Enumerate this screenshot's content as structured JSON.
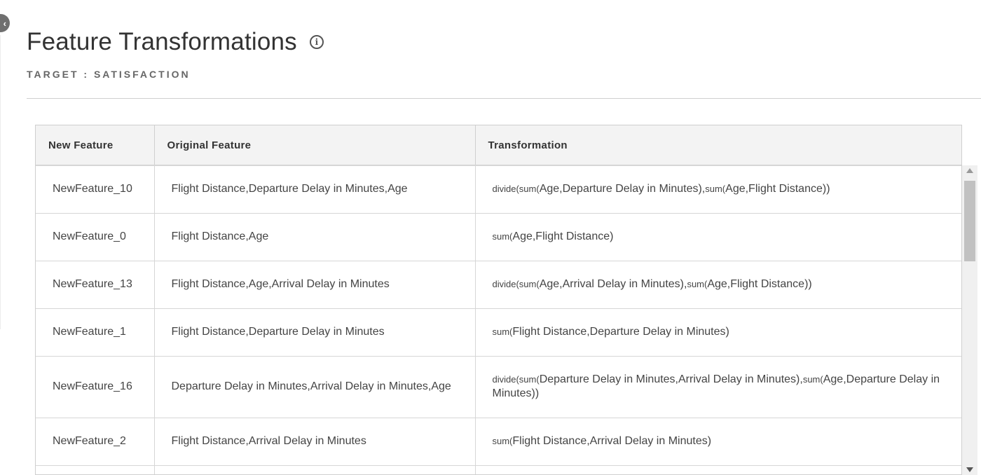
{
  "page": {
    "title": "Feature Transformations",
    "target_label": "TARGET : SATISFACTION"
  },
  "table": {
    "columns": [
      "New Feature",
      "Original Feature",
      "Transformation"
    ],
    "rows": [
      {
        "new_feature": "NewFeature_10",
        "original": "Flight Distance,Departure Delay in Minutes,Age",
        "transform": [
          {
            "t": "divide(",
            "fn": true
          },
          {
            "t": "sum(",
            "fn": true
          },
          {
            "t": "Age,Departure Delay in Minutes),",
            "fn": false
          },
          {
            "t": "sum(",
            "fn": true
          },
          {
            "t": "Age,Flight Distance))",
            "fn": false
          }
        ]
      },
      {
        "new_feature": "NewFeature_0",
        "original": "Flight Distance,Age",
        "transform": [
          {
            "t": "sum(",
            "fn": true
          },
          {
            "t": "Age,Flight Distance)",
            "fn": false
          }
        ]
      },
      {
        "new_feature": "NewFeature_13",
        "original": "Flight Distance,Age,Arrival Delay in Minutes",
        "transform": [
          {
            "t": "divide(",
            "fn": true
          },
          {
            "t": "sum(",
            "fn": true
          },
          {
            "t": "Age,Arrival Delay in Minutes),",
            "fn": false
          },
          {
            "t": "sum(",
            "fn": true
          },
          {
            "t": "Age,Flight Distance))",
            "fn": false
          }
        ]
      },
      {
        "new_feature": "NewFeature_1",
        "original": "Flight Distance,Departure Delay in Minutes",
        "transform": [
          {
            "t": "sum(",
            "fn": true
          },
          {
            "t": "Flight Distance,Departure Delay in Minutes)",
            "fn": false
          }
        ]
      },
      {
        "new_feature": "NewFeature_16",
        "original": "Departure Delay in Minutes,Arrival Delay in Minutes,Age",
        "transform": [
          {
            "t": "divide(",
            "fn": true
          },
          {
            "t": "sum(",
            "fn": true
          },
          {
            "t": "Departure Delay in Minutes,Arrival Delay in Minutes),",
            "fn": false
          },
          {
            "t": "sum(",
            "fn": true
          },
          {
            "t": "Age,Departure Delay in Minutes))",
            "fn": false
          }
        ]
      },
      {
        "new_feature": "NewFeature_2",
        "original": "Flight Distance,Arrival Delay in Minutes",
        "transform": [
          {
            "t": "sum(",
            "fn": true
          },
          {
            "t": "Flight Distance,Arrival Delay in Minutes)",
            "fn": false
          }
        ]
      }
    ]
  }
}
